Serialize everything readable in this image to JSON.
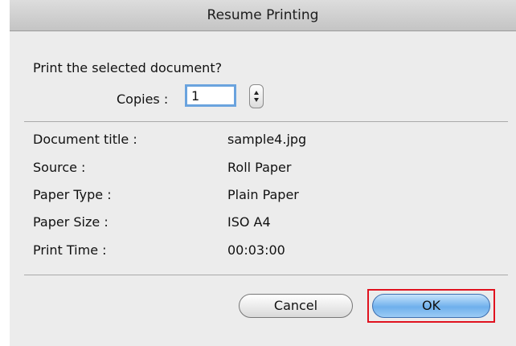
{
  "dialog": {
    "title": "Resume Printing",
    "prompt": "Print the selected document?",
    "copies_label": "Copies :",
    "copies_value": "1"
  },
  "details": [
    {
      "label": "Document title :",
      "value": "sample4.jpg"
    },
    {
      "label": "Source :",
      "value": "Roll Paper"
    },
    {
      "label": "Paper Type :",
      "value": "Plain Paper"
    },
    {
      "label": "Paper Size :",
      "value": "ISO A4"
    },
    {
      "label": "Print Time :",
      "value": "00:03:00"
    }
  ],
  "buttons": {
    "cancel": "Cancel",
    "ok": "OK"
  },
  "colors": {
    "highlight": "#e0121f",
    "default_button": "#6fb0ec",
    "focus_ring": "#6aa3de"
  }
}
